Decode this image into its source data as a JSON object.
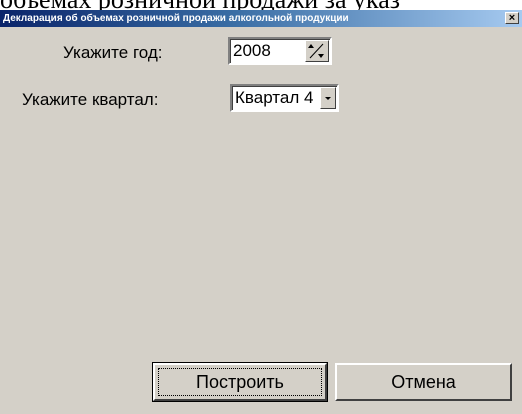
{
  "backdrop": {
    "text": "объемах розничной продажи за указ"
  },
  "window": {
    "title": "Декларация об объемах розничной продажи алкогольной продукции",
    "close_label": "×"
  },
  "form": {
    "year_label": "Укажите год:",
    "year_value": "2008",
    "quarter_label": "Укажите квартал:",
    "quarter_value": "Квартал 4"
  },
  "buttons": {
    "build_label": "Построить",
    "cancel_label": "Отмена"
  },
  "icons": {
    "spin": "spin-updown-icon",
    "dropdown": "chevron-down-icon"
  }
}
